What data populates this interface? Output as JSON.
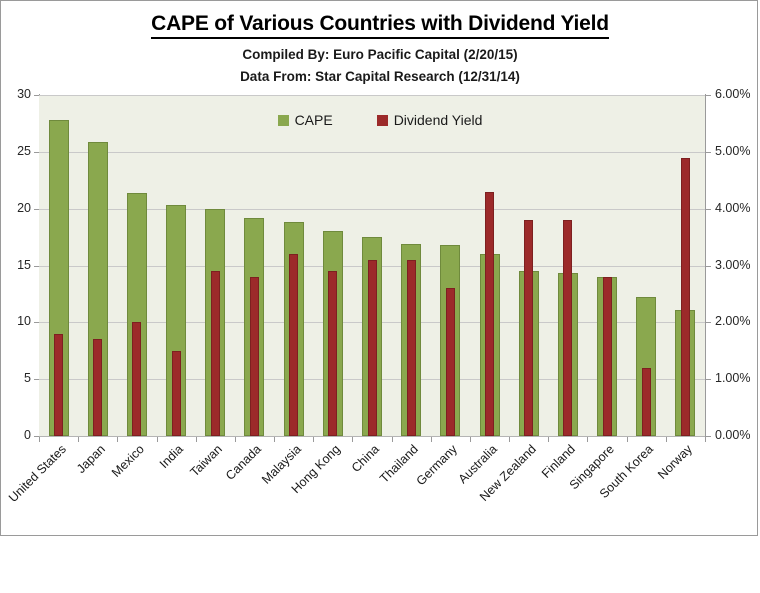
{
  "header": {
    "title": "CAPE of Various Countries with Dividend Yield",
    "subtitle_1": "Compiled By: Euro Pacific Capital (2/20/15)",
    "subtitle_2": "Data From: Star Capital Research (12/31/14)"
  },
  "legend": {
    "items": [
      {
        "label": "CAPE",
        "color": "#8aa84e"
      },
      {
        "label": "Dividend Yield",
        "color": "#9c2a2a"
      }
    ]
  },
  "colors": {
    "cape": "#8aa84e",
    "cape_border": "#6f8a3c",
    "dividend": "#9c2a2a",
    "dividend_border": "#7d2020",
    "plot_background": "#eef0e6",
    "gridline": "#c9c9c9",
    "frame_border": "#9a9a9a"
  },
  "chart_data": {
    "type": "bar",
    "title": "CAPE of Various Countries with Dividend Yield",
    "subtitle": "Compiled By: Euro Pacific Capital (2/20/15) / Data From: Star Capital Research (12/31/14)",
    "xlabel": "",
    "ylabel": "",
    "grid": true,
    "legend_position": "top-center",
    "categories": [
      "United States",
      "Japan",
      "Mexico",
      "India",
      "Taiwan",
      "Canada",
      "Malaysia",
      "Hong Kong",
      "China",
      "Thailand",
      "Germany",
      "Australia",
      "New Zealand",
      "Finland",
      "Singapore",
      "South Korea",
      "Norway"
    ],
    "series": [
      {
        "name": "CAPE",
        "axis": "left",
        "color": "#8aa84e",
        "values": [
          27.8,
          25.9,
          21.4,
          20.3,
          20.0,
          19.2,
          18.8,
          18.0,
          17.5,
          16.9,
          16.8,
          16.0,
          14.5,
          14.3,
          14.0,
          12.2,
          11.1
        ]
      },
      {
        "name": "Dividend Yield",
        "axis": "right",
        "color": "#9c2a2a",
        "unit": "%",
        "values": [
          1.8,
          1.7,
          2.0,
          1.5,
          2.9,
          2.8,
          3.2,
          2.9,
          3.1,
          3.1,
          2.6,
          4.3,
          3.8,
          3.8,
          2.8,
          1.2,
          4.9
        ]
      }
    ],
    "yaxis_left": {
      "min": 0,
      "max": 30,
      "step": 5,
      "ticks": [
        "0",
        "5",
        "10",
        "15",
        "20",
        "25",
        "30"
      ]
    },
    "yaxis_right": {
      "min": 0,
      "max": 6,
      "step": 1,
      "ticks": [
        "0.00%",
        "1.00%",
        "2.00%",
        "3.00%",
        "4.00%",
        "5.00%",
        "6.00%"
      ]
    }
  }
}
